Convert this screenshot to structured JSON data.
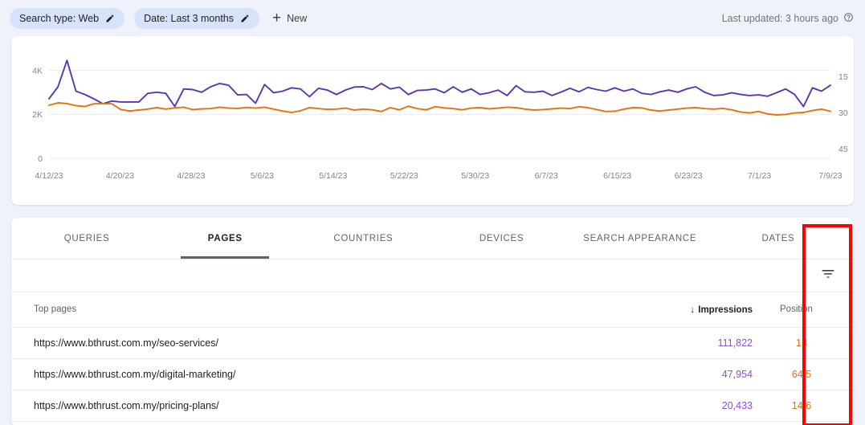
{
  "header": {
    "chips": [
      {
        "label": "Search type: Web",
        "icon": "pencil-icon"
      },
      {
        "label": "Date: Last 3 months",
        "icon": "pencil-icon"
      }
    ],
    "new_button": {
      "label": "New",
      "icon": "plus-icon"
    },
    "last_updated": "Last updated: 3 hours ago",
    "help_icon": "help-circle-icon"
  },
  "colors": {
    "impressions": "#5e35b1",
    "position": "#e8710a",
    "page_background": "#eff2fa",
    "chip_background": "#d7e3fb",
    "annotation": "#ff0000",
    "impressions_text": "#8d4ed8"
  },
  "chart_data": {
    "type": "line",
    "title": "",
    "xlabel": "",
    "grid": true,
    "legend": "none",
    "x_ticks": [
      "4/12/23",
      "4/20/23",
      "4/28/23",
      "5/6/23",
      "5/14/23",
      "5/22/23",
      "5/30/23",
      "6/7/23",
      "6/15/23",
      "6/23/23",
      "7/1/23",
      "7/9/23"
    ],
    "axes": [
      {
        "side": "left",
        "name": "Impressions",
        "ticks": [
          "0",
          "2K",
          "4K"
        ],
        "tick_values": [
          0,
          2000,
          4000
        ],
        "range": [
          0,
          4600
        ]
      },
      {
        "side": "right",
        "name": "Position",
        "ticks": [
          "15",
          "30",
          "45"
        ],
        "tick_values": [
          15,
          30,
          45
        ],
        "range": [
          7,
          49
        ],
        "inverted": true
      }
    ],
    "series": [
      {
        "name": "Impressions",
        "axis": "left",
        "color": "#5e35b1",
        "values": [
          2700,
          3250,
          4450,
          3050,
          2900,
          2700,
          2480,
          2600,
          2560,
          2560,
          2560,
          2950,
          3000,
          2950,
          2350,
          3150,
          3120,
          3000,
          3250,
          3400,
          3320,
          2880,
          2900,
          2500,
          3350,
          2980,
          3050,
          3200,
          3150,
          2800,
          3180,
          3100,
          2900,
          3100,
          3240,
          3250,
          3120,
          3400,
          3150,
          3230,
          2900,
          3080,
          3100,
          3150,
          2980,
          3250,
          3000,
          3150,
          2900,
          2980,
          3100,
          2850,
          3300,
          3020,
          3000,
          3050,
          2850,
          3010,
          3180,
          3020,
          3220,
          3120,
          3050,
          3200,
          3050,
          3150,
          2950,
          2900,
          3020,
          3100,
          3000,
          3150,
          3250,
          3000,
          2850,
          2880,
          2980,
          2900,
          2850,
          2880,
          2820,
          2980,
          3150,
          2900,
          2350,
          3200,
          3050,
          3320
        ]
      },
      {
        "name": "Position",
        "axis": "right",
        "color": "#e8710a",
        "values": [
          27.0,
          26.0,
          26.3,
          27.2,
          27.5,
          26.4,
          26.3,
          26.4,
          28.8,
          29.4,
          29.0,
          28.6,
          28.0,
          28.6,
          28.1,
          27.8,
          28.8,
          28.5,
          28.4,
          27.8,
          28.2,
          28.3,
          27.9,
          28.2,
          27.8,
          28.6,
          29.4,
          30.0,
          29.3,
          28.0,
          28.4,
          28.7,
          28.6,
          28.2,
          29.0,
          28.6,
          28.9,
          29.6,
          28.0,
          28.9,
          27.4,
          28.4,
          28.9,
          27.6,
          28.1,
          28.4,
          28.9,
          28.2,
          28.0,
          28.5,
          28.2,
          27.8,
          28.0,
          28.6,
          29.0,
          28.8,
          28.5,
          28.2,
          28.4,
          27.6,
          28.0,
          28.8,
          29.6,
          29.5,
          28.6,
          28.0,
          28.1,
          29.0,
          29.4,
          29.0,
          28.6,
          28.2,
          28.0,
          28.4,
          28.6,
          28.3,
          28.9,
          29.8,
          30.2,
          29.6,
          30.6,
          31.0,
          30.8,
          30.2,
          30.0,
          29.2,
          28.6,
          29.5
        ]
      }
    ]
  },
  "tabs": [
    {
      "label": "QUERIES",
      "active": false
    },
    {
      "label": "PAGES",
      "active": true
    },
    {
      "label": "COUNTRIES",
      "active": false
    },
    {
      "label": "DEVICES",
      "active": false
    },
    {
      "label": "SEARCH APPEARANCE",
      "active": false
    },
    {
      "label": "DATES",
      "active": false
    }
  ],
  "toolbar": {
    "filter_icon": "filter-icon"
  },
  "table": {
    "columns": {
      "page": "Top pages",
      "impressions": "Impressions",
      "position": "Position",
      "sort_arrow": "↓"
    },
    "rows": [
      {
        "page": "https://www.bthrust.com.my/seo-services/",
        "impressions": "111,822",
        "position": "13"
      },
      {
        "page": "https://www.bthrust.com.my/digital-marketing/",
        "impressions": "47,954",
        "position": "64.5"
      },
      {
        "page": "https://www.bthrust.com.my/pricing-plans/",
        "impressions": "20,433",
        "position": "14.6"
      }
    ]
  }
}
